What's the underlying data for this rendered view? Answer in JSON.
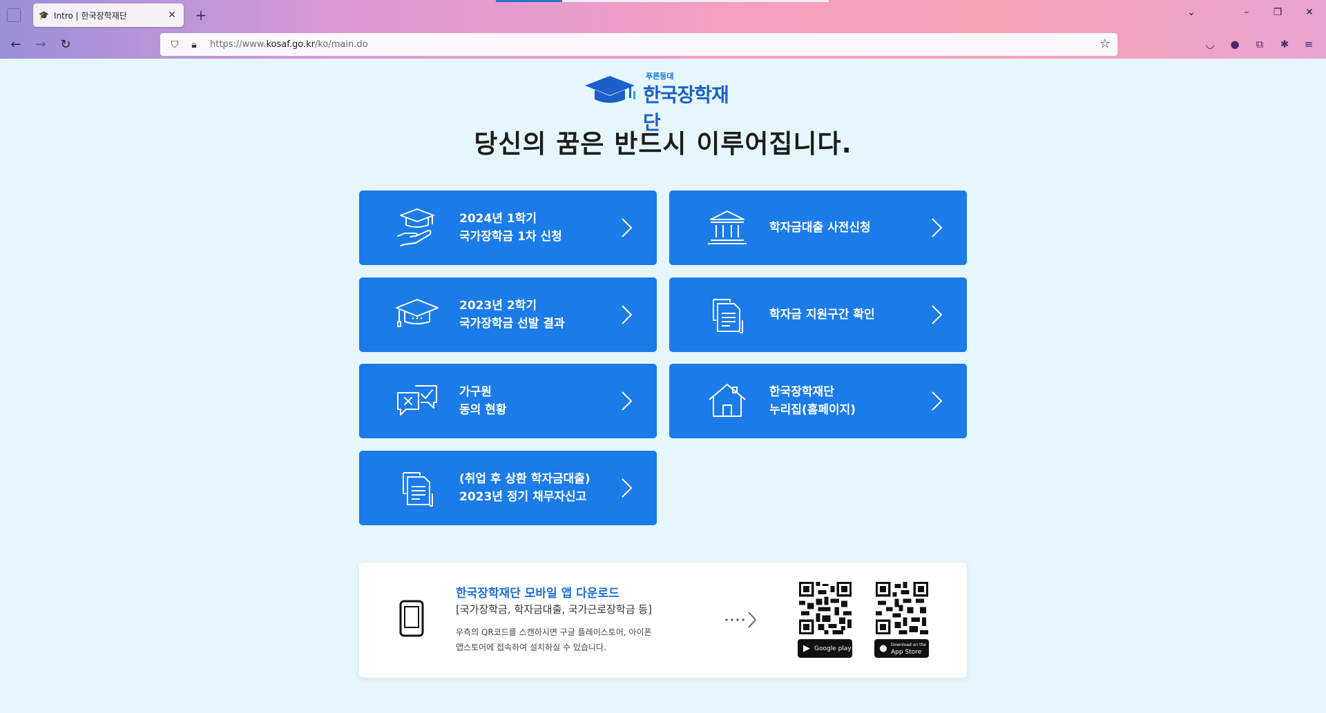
{
  "browser": {
    "tab_title": "Intro | 한국장학재단",
    "url_prefix": "https://www.",
    "url_domain": "kosaf.go.kr",
    "url_path": "/ko/main.do",
    "new_tab_glyph": "+",
    "close_glyph": "✕"
  },
  "logo": {
    "small_text": "푸른등대",
    "main_text": "한국장학재단",
    "brand_color": "#1b5fc8"
  },
  "headline": "당신의 꿈은 반드시 이루어집니다.",
  "cards": [
    {
      "icon": "graduation-hand-icon",
      "lines": [
        "2024년 1학기",
        "국가장학금 1차 신청"
      ]
    },
    {
      "icon": "bank-building-icon",
      "lines": [
        "학자금대출 사전신청"
      ]
    },
    {
      "icon": "graduation-cap-icon",
      "lines": [
        "2023년 2학기",
        "국가장학금 선발 결과"
      ]
    },
    {
      "icon": "documents-icon",
      "lines": [
        "학자금 지원구간 확인"
      ]
    },
    {
      "icon": "consent-chat-icon",
      "lines": [
        "가구원",
        "동의 현황"
      ]
    },
    {
      "icon": "home-icon",
      "lines": [
        "한국장학재단",
        "누리집(홈페이지)"
      ]
    },
    {
      "icon": "documents-icon",
      "lines": [
        "(취업 후 상환 학자금대출)",
        "2023년 정기 채무자신고"
      ]
    }
  ],
  "app_download": {
    "title": "한국장학재단 모바일 앱 다운로드",
    "subtitle": "[국가장학금, 학자금대출, 국가근로장학금 등]",
    "desc_line1": "우측의 QR코드를 스캔하시면 구글 플레이스토어, 아이폰",
    "desc_line2": "앱스토어에 접속하여 설치하실 수 있습니다.",
    "google_badge": "Google play",
    "apple_badge_top": "Download on the",
    "apple_badge_main": "App Store"
  },
  "colors": {
    "page_bg": "#e6f6fd",
    "card_blue": "#1b7be9",
    "title_blue": "#1b6fd8"
  }
}
